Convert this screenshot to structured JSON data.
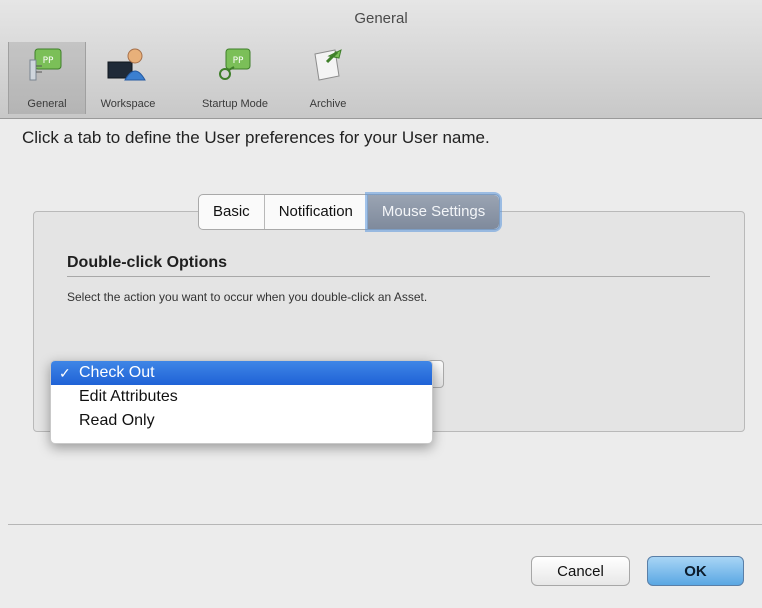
{
  "window": {
    "title": "General"
  },
  "toolbar": {
    "items": [
      {
        "label": "General",
        "icon": "general-pp-icon",
        "selected": true
      },
      {
        "label": "Workspace",
        "icon": "workspace-user-icon",
        "selected": false
      },
      {
        "label": "Startup Mode",
        "icon": "startup-mode-icon",
        "selected": false
      },
      {
        "label": "Archive",
        "icon": "archive-icon",
        "selected": false
      }
    ]
  },
  "intro": "Click a tab to define the User preferences for your User name.",
  "tabs": [
    {
      "label": "Basic",
      "active": false
    },
    {
      "label": "Notification",
      "active": false
    },
    {
      "label": "Mouse Settings",
      "active": true
    }
  ],
  "section": {
    "title": "Double-click Options",
    "description": "Select the action you want to occur when you double-click an Asset."
  },
  "dropdown": {
    "selected_mark": "✓",
    "options": [
      {
        "label": "Check Out",
        "selected": true
      },
      {
        "label": "Edit Attributes",
        "selected": false
      },
      {
        "label": "Read Only",
        "selected": false
      }
    ]
  },
  "buttons": {
    "cancel": "Cancel",
    "ok": "OK"
  },
  "colors": {
    "selection_blue": "#2f72dc",
    "tab_active": "#8a95a6",
    "ok_button": "#6fb3e8"
  }
}
